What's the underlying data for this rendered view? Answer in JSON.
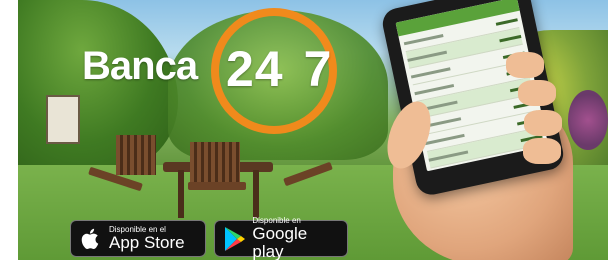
{
  "banner": {
    "brand": "Banca",
    "number_left": "24",
    "number_right": "7",
    "accent_color": "#f08a1c"
  },
  "stores": {
    "apple": {
      "line1": "Disponible en el",
      "line2": "App Store",
      "icon": "apple-icon"
    },
    "google": {
      "line1": "Disponible en",
      "line2": "Google play",
      "icon": "google-play-icon"
    }
  }
}
